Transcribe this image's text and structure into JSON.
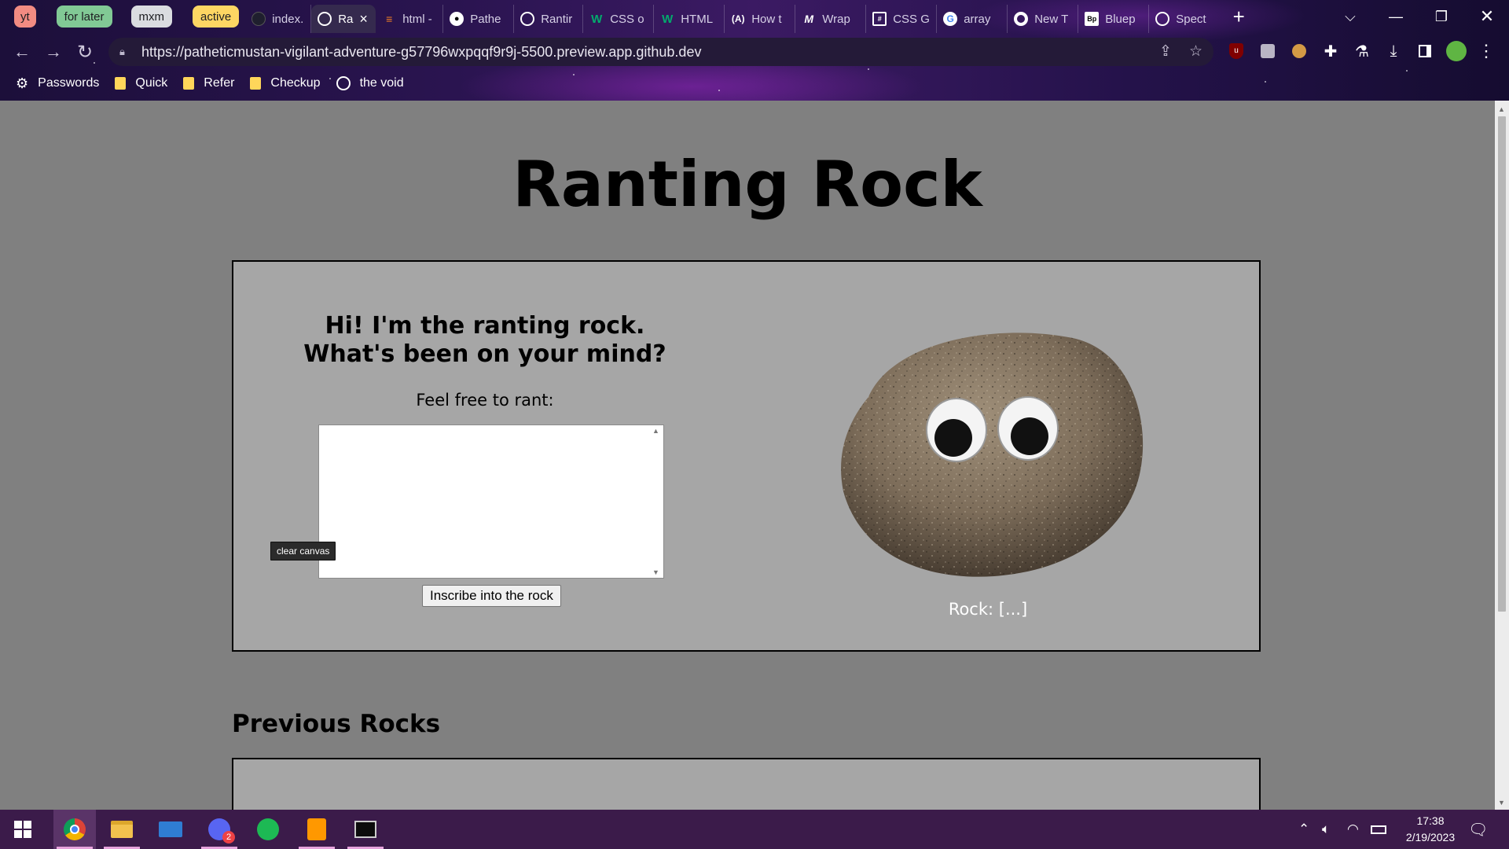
{
  "browser": {
    "tab_groups": [
      {
        "label": "yt",
        "color": "#f28b82"
      },
      {
        "label": "for later",
        "color": "#81c995"
      },
      {
        "label": "mxm",
        "color": "#dadce0"
      },
      {
        "label": "active",
        "color": "#fdd663"
      }
    ],
    "tabs": [
      {
        "title": "index.",
        "icon": "dark-circle-icon",
        "icon_color": "#1f1f2e"
      },
      {
        "title": "Ra",
        "icon": "globe-icon",
        "icon_color": "#ffffff",
        "active": true
      },
      {
        "title": "html -",
        "icon": "stackoverflow-icon",
        "icon_color": "#f48024"
      },
      {
        "title": "Pathe",
        "icon": "github-icon",
        "icon_color": "#ffffff"
      },
      {
        "title": "Rantir",
        "icon": "globe-icon",
        "icon_color": "#ffffff"
      },
      {
        "title": "CSS o",
        "icon": "w3schools-icon",
        "icon_color": "#04aa6d"
      },
      {
        "title": "HTML",
        "icon": "w3schools-icon",
        "icon_color": "#04aa6d"
      },
      {
        "title": "How t",
        "icon": "angular-bracket-icon",
        "icon_color": "#ffffff"
      },
      {
        "title": "Wrap",
        "icon": "medium-icon",
        "icon_color": "#ffffff"
      },
      {
        "title": "CSS G",
        "icon": "grid-icon",
        "icon_color": "#ffffff"
      },
      {
        "title": "array",
        "icon": "google-icon",
        "icon_color": "#ffffff"
      },
      {
        "title": "New T",
        "icon": "chrome-icon",
        "icon_color": "#ffffff"
      },
      {
        "title": "Bluep",
        "icon": "bp-icon",
        "icon_color": "#ffffff"
      },
      {
        "title": "Spect",
        "icon": "globe-icon",
        "icon_color": "#ffffff"
      }
    ],
    "url": "https://patheticmustan-vigilant-adventure-g57796wxpqqf9r9j-5500.preview.app.github.dev",
    "bookmarks": [
      {
        "label": "Passwords",
        "icon": "gear-icon"
      },
      {
        "label": "Quick",
        "icon": "folder-icon"
      },
      {
        "label": "Refer",
        "icon": "folder-icon"
      },
      {
        "label": "Checkup",
        "icon": "folder-icon"
      },
      {
        "label": "the void",
        "icon": "globe-icon"
      }
    ]
  },
  "page": {
    "title": "Ranting Rock",
    "greeting_line1": "Hi! I'm the ranting rock.",
    "greeting_line2": "What's been on your mind?",
    "rant_label": "Feel free to rant:",
    "rant_value": "",
    "clear_canvas_label": "clear canvas",
    "inscribe_button": "Inscribe into the rock",
    "rock_response": "Rock: [...]",
    "previous_heading": "Previous Rocks"
  },
  "taskbar": {
    "apps": [
      "windows-start-icon",
      "chrome-icon",
      "file-explorer-icon",
      "mail-icon",
      "discord-icon",
      "spotify-icon",
      "sublime-text-icon",
      "terminal-icon"
    ],
    "chrome_badge": "",
    "discord_badge": "2",
    "time": "17:38",
    "date": "2/19/2023"
  }
}
